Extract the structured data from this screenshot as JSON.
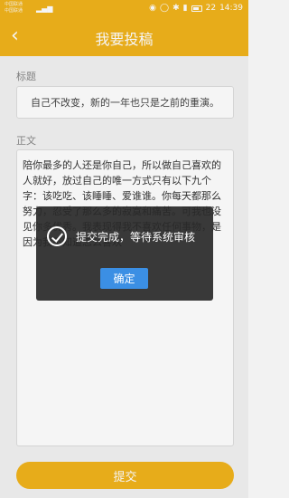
{
  "status_bar": {
    "carrier_line1": "中国联通",
    "carrier_line2": "中国联通",
    "signal": "▂▄▆",
    "icons": [
      "eye-icon",
      "alarm-icon",
      "bluetooth-icon",
      "vibrate-icon",
      "battery-icon"
    ],
    "battery": "22",
    "time": "14:39"
  },
  "header": {
    "back_icon": "‹",
    "title": "我要投稿"
  },
  "form": {
    "title_label": "标题",
    "title_value": "自己不改变，新的一年也只是之前的重演。",
    "content_label": "正文",
    "content_value": "陪你最多的人还是你自己，所以做自己喜欢的人就好，放过自己的唯一方式只有以下九个字：该吃吃、该睡睡、爱谁谁。你每天都那么努力，忍受了那么多的寂寞和痛苦。可我也没见你多优秀。我表现得我不喜欢任何事物，是因为我不知道怎么喜欢"
  },
  "submit_label": "提交",
  "dialog": {
    "message": "提交完成，等待系统审核",
    "ok_label": "确定"
  },
  "colors": {
    "accent": "#f1b31c",
    "dialog_button": "#3b8fe4"
  }
}
